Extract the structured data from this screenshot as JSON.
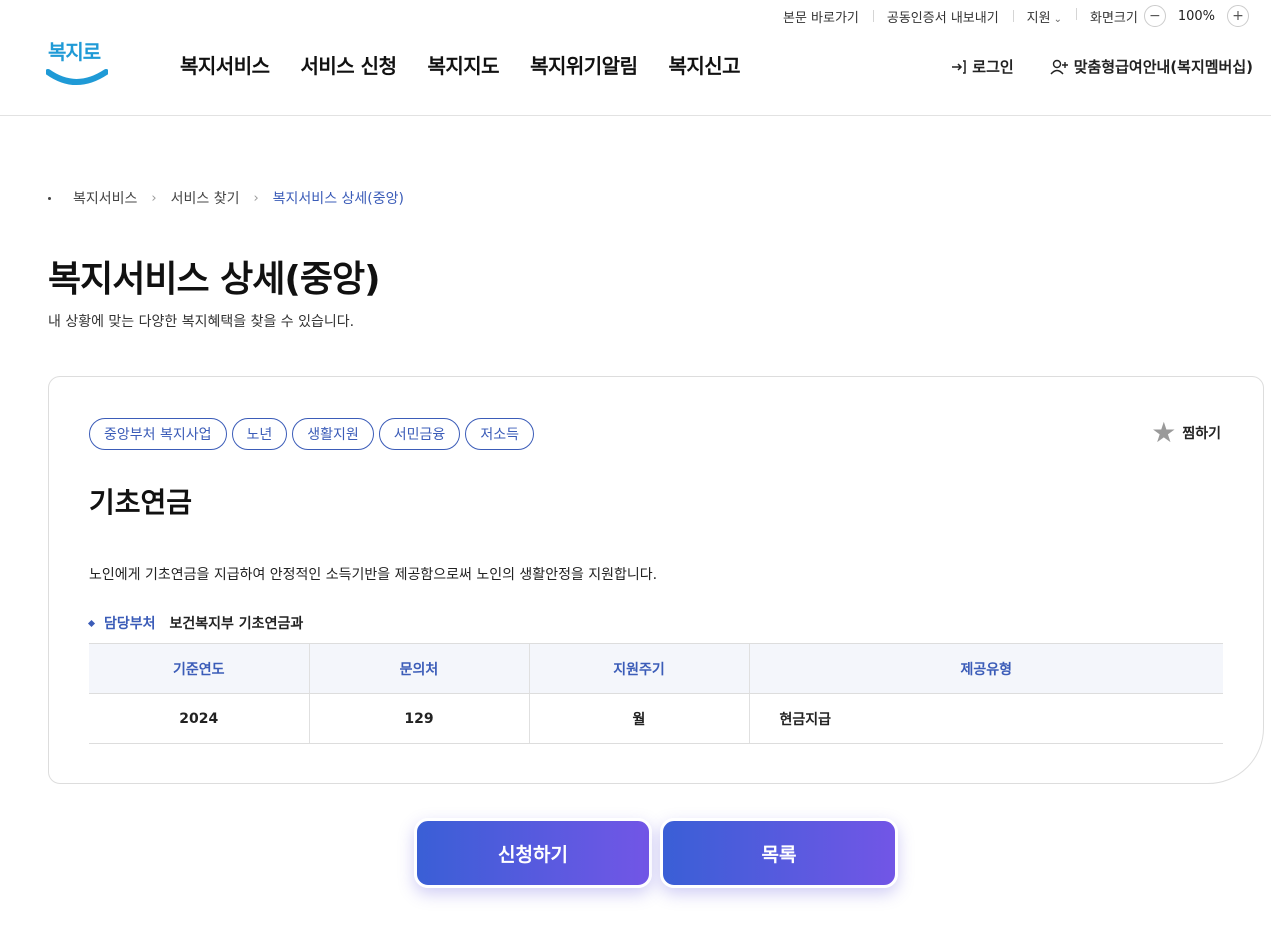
{
  "utility": {
    "skip": "본문 바로가기",
    "cert": "공동인증서 내보내기",
    "support": "지원",
    "zoom_label": "화면크기",
    "zoom_value": "100%"
  },
  "header": {
    "logo_text": "복지로",
    "nav": [
      "복지서비스",
      "서비스 신청",
      "복지지도",
      "복지위기알림",
      "복지신고"
    ],
    "login": "로그인",
    "membership": "맞춤형급여안내(복지멤버십)"
  },
  "breadcrumb": [
    "복지서비스",
    "서비스 찾기",
    "복지서비스 상세(중앙)"
  ],
  "page": {
    "title": "복지서비스 상세(중앙)",
    "subtitle": "내 상황에 맞는 다양한 복지혜택을 찾을 수 있습니다."
  },
  "service": {
    "tags": [
      "중앙부처 복지사업",
      "노년",
      "생활지원",
      "서민금융",
      "저소득"
    ],
    "favorite_label": "찜하기",
    "title": "기초연금",
    "description": "노인에게 기초연금을 지급하여 안정적인 소득기반을 제공함으로써 노인의 생활안정을 지원합니다.",
    "dept_label": "담당부처",
    "dept_value": "보건복지부 기초연금과",
    "table": {
      "headers": [
        "기준연도",
        "문의처",
        "지원주기",
        "제공유형"
      ],
      "row": [
        "2024",
        "129",
        "월",
        "현금지급"
      ]
    }
  },
  "actions": {
    "apply": "신청하기",
    "list": "목록"
  },
  "colors": {
    "accent": "#3b5cb8",
    "button_start": "#3a5fd6",
    "button_end": "#7256e6"
  }
}
